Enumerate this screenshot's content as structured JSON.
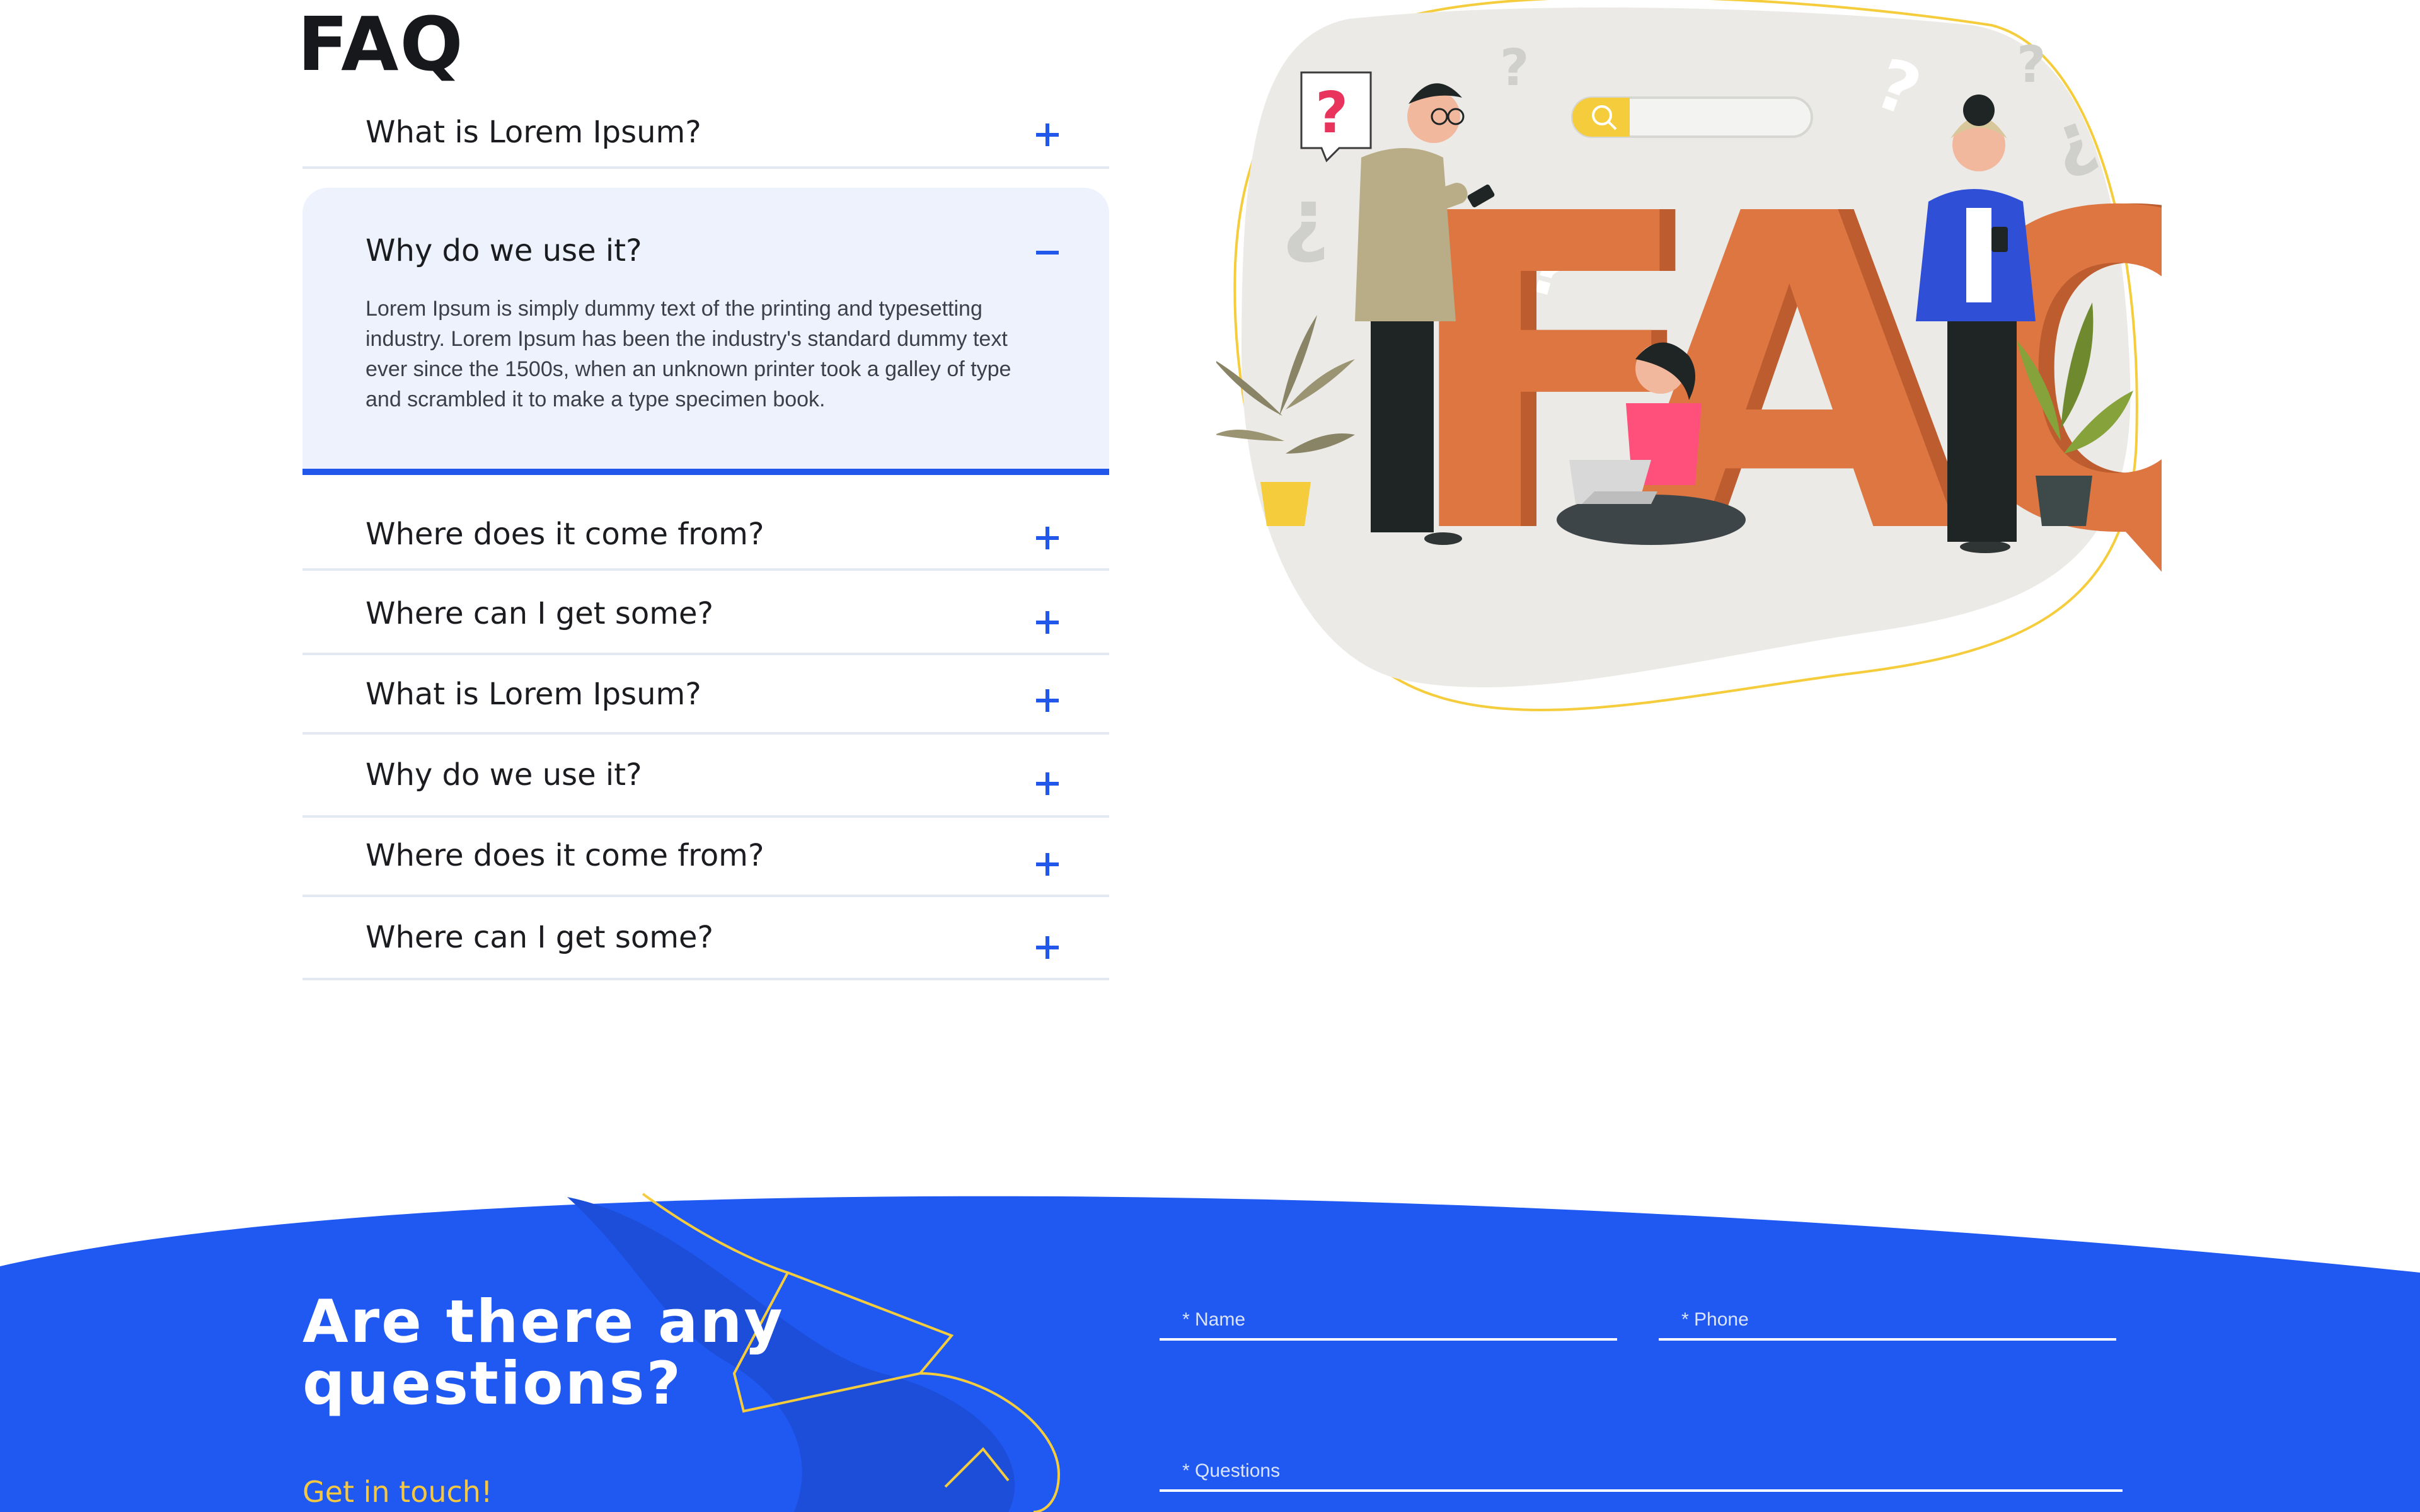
{
  "faq": {
    "title": "FAQ",
    "items": [
      {
        "question": "What is Lorem Ipsum?",
        "expanded": false
      },
      {
        "question": "Why do we use it?",
        "expanded": true,
        "answer": "Lorem Ipsum is simply dummy text of the printing and typesetting industry. Lorem Ipsum has been the industry's standard dummy text ever since the 1500s, when an unknown printer took a galley of type and scrambled it to make a type specimen book."
      },
      {
        "question": "Where does it come from?",
        "expanded": false
      },
      {
        "question": "Where can I get some?",
        "expanded": false
      },
      {
        "question": "What is Lorem Ipsum?",
        "expanded": false
      },
      {
        "question": "Why do we use it?",
        "expanded": false
      },
      {
        "question": "Where does it come from?",
        "expanded": false
      },
      {
        "question": "Where can I get some?",
        "expanded": false
      }
    ]
  },
  "illustration": {
    "big_letters": "FAQ",
    "bubble_mark": "?"
  },
  "contact": {
    "title_line1": "Are there any",
    "title_line2": "questions?",
    "subtitle": "Get in touch!",
    "name_placeholder": "* Name",
    "phone_placeholder": "* Phone",
    "questions_placeholder": "* Questions"
  },
  "colors": {
    "accent_blue": "#2257ec",
    "accent_yellow": "#f5c842",
    "orange": "#d9703e",
    "open_panel_bg": "#eef2fd"
  }
}
